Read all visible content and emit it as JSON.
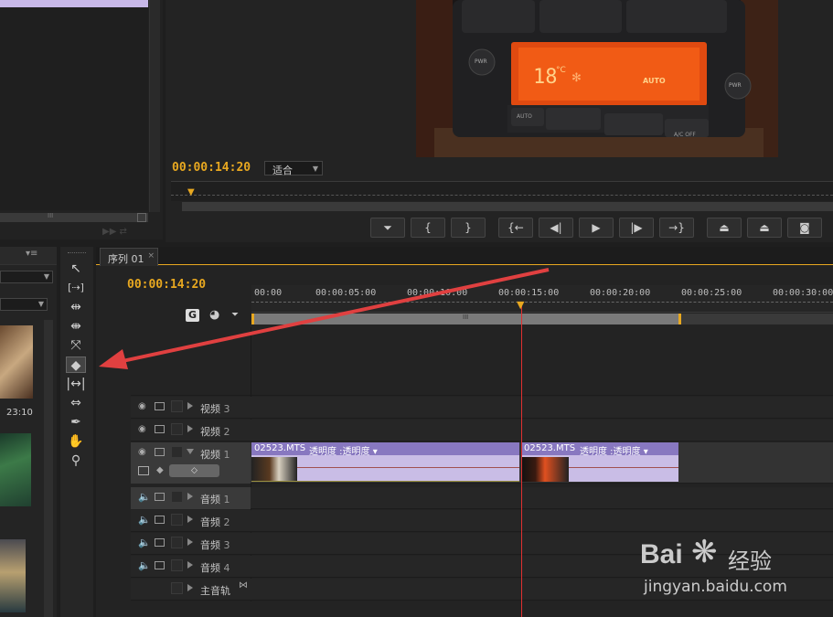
{
  "program_monitor": {
    "timecode": "00:00:14:20",
    "fit_dropdown": "适合",
    "transport": [
      "mark-in",
      "bracket-in",
      "bracket-out",
      "go-to-in",
      "step-back",
      "play",
      "step-forward",
      "go-to-out",
      "lift",
      "extract",
      "export-frame"
    ]
  },
  "display": {
    "temp": "18",
    "unit": "°C",
    "mode": "AUTO",
    "pwr": "PWR",
    "auto_btn": "AUTO",
    "ac_btn": "A/C OFF"
  },
  "timeline": {
    "tab": "序列 01",
    "timecode": "00:00:14:20",
    "ruler_labels": [
      "00:00",
      "00:00:05:00",
      "00:00:10:00",
      "00:00:15:00",
      "00:00:20:00",
      "00:00:25:00",
      "00:00:30:00"
    ],
    "scroll_mark": "III",
    "tracks": {
      "v3": {
        "name": "视频",
        "num": "3"
      },
      "v2": {
        "name": "视频",
        "num": "2"
      },
      "v1": {
        "name": "视频",
        "num": "1"
      },
      "a1": {
        "name": "音频",
        "num": "1"
      },
      "a2": {
        "name": "音频",
        "num": "2"
      },
      "a3": {
        "name": "音频",
        "num": "3"
      },
      "a4": {
        "name": "音频",
        "num": "4"
      },
      "master": {
        "name": "主音轨"
      }
    },
    "clips": [
      {
        "name": "02523.MTS",
        "effect": "透明度 :透明度"
      },
      {
        "name": "02523.MTS",
        "effect": "透明度 :透明度"
      }
    ]
  },
  "project": {
    "thumb_duration": "23:10",
    "scroll_mark": "III"
  },
  "watermark": {
    "brand": "Bai",
    "brand2": "经验",
    "url": "jingyan.baidu.com"
  },
  "colors": {
    "accent": "#e8a820",
    "clip": "#8878c0",
    "playhead": "#e03030",
    "arrow": "#e04040"
  }
}
